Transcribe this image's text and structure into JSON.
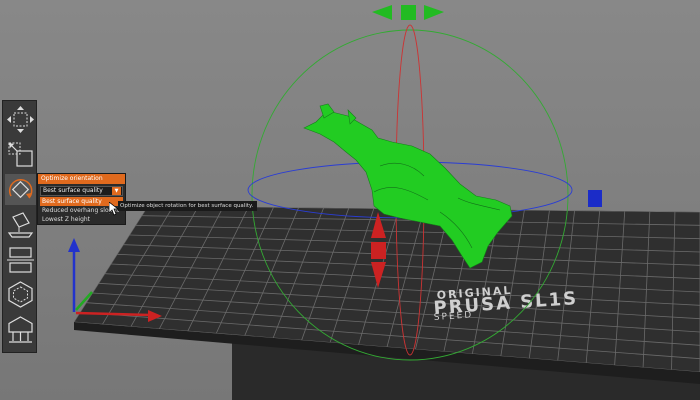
{
  "printer": {
    "brand_line": "ORIGINAL",
    "model_line": "PRUSA SL1S",
    "sub_line": "SPEED"
  },
  "toolbar": {
    "tools": [
      {
        "icon": "move-icon"
      },
      {
        "icon": "scale-icon"
      },
      {
        "icon": "rotate-icon",
        "active": true
      },
      {
        "icon": "place-on-face-icon"
      },
      {
        "icon": "cut-icon"
      },
      {
        "icon": "hollow-icon"
      },
      {
        "icon": "support-points-icon"
      }
    ]
  },
  "optimize_panel": {
    "title": "Optimize orientation",
    "selected_value": "Best surface quality",
    "options": [
      "Best surface quality",
      "Reduced overhang slopes",
      "Lowest Z height"
    ],
    "highlighted_index": 0
  },
  "tooltip": {
    "text": "Optimize object rotation for best surface quality."
  },
  "colors": {
    "accent": "#e06a1e",
    "model": "#22cc22",
    "axis_x": "#cc2222",
    "axis_y": "#22aa22",
    "axis_z": "#2233cc"
  }
}
